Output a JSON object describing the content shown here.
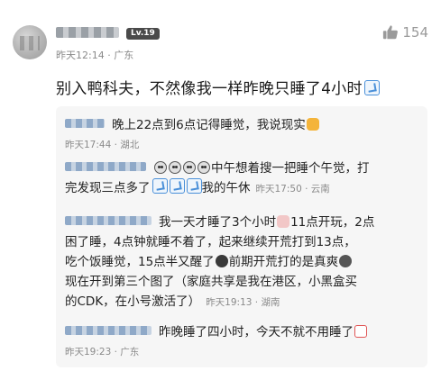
{
  "comment": {
    "level": "Lv.19",
    "meta": "昨天12:14 · 广东",
    "like_count": "154",
    "text": "别入鸭科夫，不然像我一样昨晚只睡了4小时"
  },
  "replies": [
    {
      "text": "晚上22点到6点记得睡觉，我说现实",
      "meta": "昨天17:44 · 湖北"
    },
    {
      "line1": "中午想着搜一把睡个午觉，打",
      "line2": "完发现三点多了",
      "line2b": "我的午休",
      "meta": "昨天17:50 · 云南"
    },
    {
      "line1a": "我一天才睡了3个小时",
      "line1b": "11点开玩，2点",
      "line2": "困了睡，4点钟就睡不着了，起来继续开荒打到13点，",
      "line3a": "吃个饭睡觉，15点半又醒了",
      "line3b": "前期开荒打的是真爽",
      "line4": "现在开到第三个图了（家庭共享是我在港区，小黑盒买",
      "line5": "的CDK，在小号激活了）",
      "meta": "昨天19:13 · 湖南"
    },
    {
      "text": "昨晚睡了四小时，今天不就不用睡了",
      "meta": "昨天19:23 · 广东"
    }
  ]
}
